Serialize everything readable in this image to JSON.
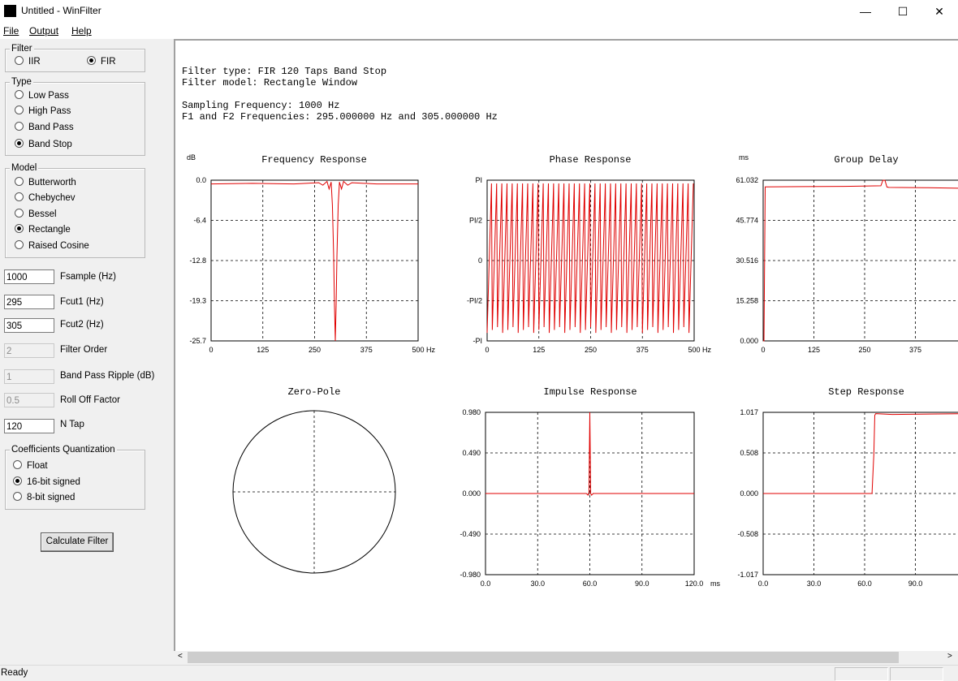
{
  "window": {
    "title": "Untitled - WinFilter",
    "minimize": "—",
    "maximize": "☐",
    "close": "✕"
  },
  "menu": {
    "file": "File",
    "output": "Output",
    "help": "Help"
  },
  "filter_group": {
    "title": "Filter",
    "iir": "IIR",
    "fir": "FIR",
    "selected": "FIR"
  },
  "type_group": {
    "title": "Type",
    "low_pass": "Low Pass",
    "high_pass": "High Pass",
    "band_pass": "Band Pass",
    "band_stop": "Band Stop",
    "selected": "Band Stop"
  },
  "model_group": {
    "title": "Model",
    "butterworth": "Butterworth",
    "chebychev": "Chebychev",
    "bessel": "Bessel",
    "rectangle": "Rectangle",
    "raised_cosine": "Raised Cosine",
    "selected": "Rectangle"
  },
  "params": {
    "fsample": {
      "value": "1000",
      "label": "Fsample (Hz)"
    },
    "fcut1": {
      "value": "295",
      "label": "Fcut1 (Hz)"
    },
    "fcut2": {
      "value": "305",
      "label": "Fcut2 (Hz)"
    },
    "filter_order": {
      "value": "2",
      "label": "Filter Order"
    },
    "ripple": {
      "value": "1",
      "label": "Band Pass Ripple (dB)"
    },
    "rolloff": {
      "value": "0.5",
      "label": "Roll Off Factor"
    },
    "ntap": {
      "value": "120",
      "label": "N Tap"
    }
  },
  "quant_group": {
    "title": "Coefficients Quantization",
    "float": "Float",
    "bit16": "16-bit signed",
    "bit8": "8-bit signed",
    "selected": "16-bit signed"
  },
  "calculate_button": "Calculate Filter",
  "info": {
    "line1": "Filter type: FIR 120 Taps Band Stop",
    "line2": "Filter model: Rectangle Window",
    "line3": "Sampling Frequency: 1000 Hz",
    "line4": "F1 and F2 Frequencies: 295.000000 Hz and 305.000000 Hz"
  },
  "status": {
    "text": "Ready"
  },
  "accent_color": "#e00000",
  "chart_data": [
    {
      "type": "line",
      "title": "Frequency Response",
      "ylabel": "dB",
      "xlabel": "Hz",
      "ylim": [
        -25.7,
        0.0
      ],
      "xlim": [
        0,
        500
      ],
      "yticks": [
        "0.0",
        "-6.4",
        "-12.8",
        "-19.3",
        "-25.7"
      ],
      "xticks": [
        "0",
        "125",
        "250",
        "375",
        "500"
      ],
      "series": [
        {
          "x": [
            0,
            100,
            200,
            260,
            270,
            280,
            285,
            290,
            293,
            296,
            298,
            300,
            302,
            304,
            307,
            310,
            315,
            320,
            330,
            340,
            400,
            500
          ],
          "y": [
            -0.6,
            -0.5,
            -0.6,
            -0.4,
            -0.8,
            -0.2,
            -1.4,
            -0.3,
            -4.0,
            -12.0,
            -20.0,
            -25.7,
            -20.0,
            -12.0,
            -4.0,
            -0.3,
            -1.4,
            -0.2,
            -0.8,
            -0.4,
            -0.6,
            -0.6
          ]
        }
      ]
    },
    {
      "type": "line",
      "title": "Phase Response",
      "xlabel": "Hz",
      "ylim": [
        "-PI",
        "PI"
      ],
      "xlim": [
        0,
        500
      ],
      "yticks": [
        "PI",
        "PI/2",
        "0",
        "-PI/2",
        "-PI"
      ],
      "xticks": [
        "0",
        "125",
        "250",
        "375",
        "500"
      ],
      "pattern": "sawtooth wrapping between -PI and PI, ~40 cycles"
    },
    {
      "type": "line",
      "title": "Group Delay",
      "ylabel": "ms",
      "ylim": [
        0.0,
        61.032
      ],
      "xlim": [
        0,
        500
      ],
      "yticks": [
        "61.032",
        "45.774",
        "30.516",
        "15.258",
        "0.000"
      ],
      "xticks": [
        "0",
        "125",
        "250",
        "375"
      ],
      "series": [
        {
          "x": [
            0,
            2,
            5,
            100,
            200,
            290,
            295,
            300,
            305,
            310,
            400,
            480
          ],
          "y": [
            0,
            0,
            58.5,
            58.6,
            58.7,
            58.9,
            61.0,
            61.0,
            58.4,
            58.3,
            58.2,
            58.0
          ]
        }
      ]
    },
    {
      "type": "scatter",
      "title": "Zero-Pole",
      "note": "unit circle with axes, no visible poles/zeros"
    },
    {
      "type": "line",
      "title": "Impulse Response",
      "xlabel": "ms",
      "ylim": [
        -0.98,
        0.98
      ],
      "xlim": [
        0.0,
        120.0
      ],
      "yticks": [
        "0.980",
        "0.490",
        "0.000",
        "-0.490",
        "-0.980"
      ],
      "xticks": [
        "0.0",
        "30.0",
        "60.0",
        "90.0",
        "120.0"
      ],
      "series": [
        {
          "x": [
            0,
            58,
            59,
            59.5,
            60,
            60.5,
            61,
            62,
            120
          ],
          "y": [
            0,
            0,
            -0.02,
            0,
            0.98,
            0,
            -0.02,
            0,
            0
          ]
        }
      ]
    },
    {
      "type": "line",
      "title": "Step Response",
      "xlabel": "ms",
      "ylim": [
        -1.017,
        1.017
      ],
      "xlim": [
        0.0,
        110
      ],
      "yticks": [
        "1.017",
        "0.508",
        "0.000",
        "-0.508",
        "-1.017"
      ],
      "xticks": [
        "0.0",
        "30.0",
        "60.0",
        "90.0"
      ],
      "series": [
        {
          "x": [
            0,
            58,
            59,
            60,
            60.5,
            61,
            70,
            110
          ],
          "y": [
            0,
            0,
            0,
            0.5,
            0.98,
            1.0,
            0.99,
            1.0
          ]
        }
      ]
    }
  ]
}
